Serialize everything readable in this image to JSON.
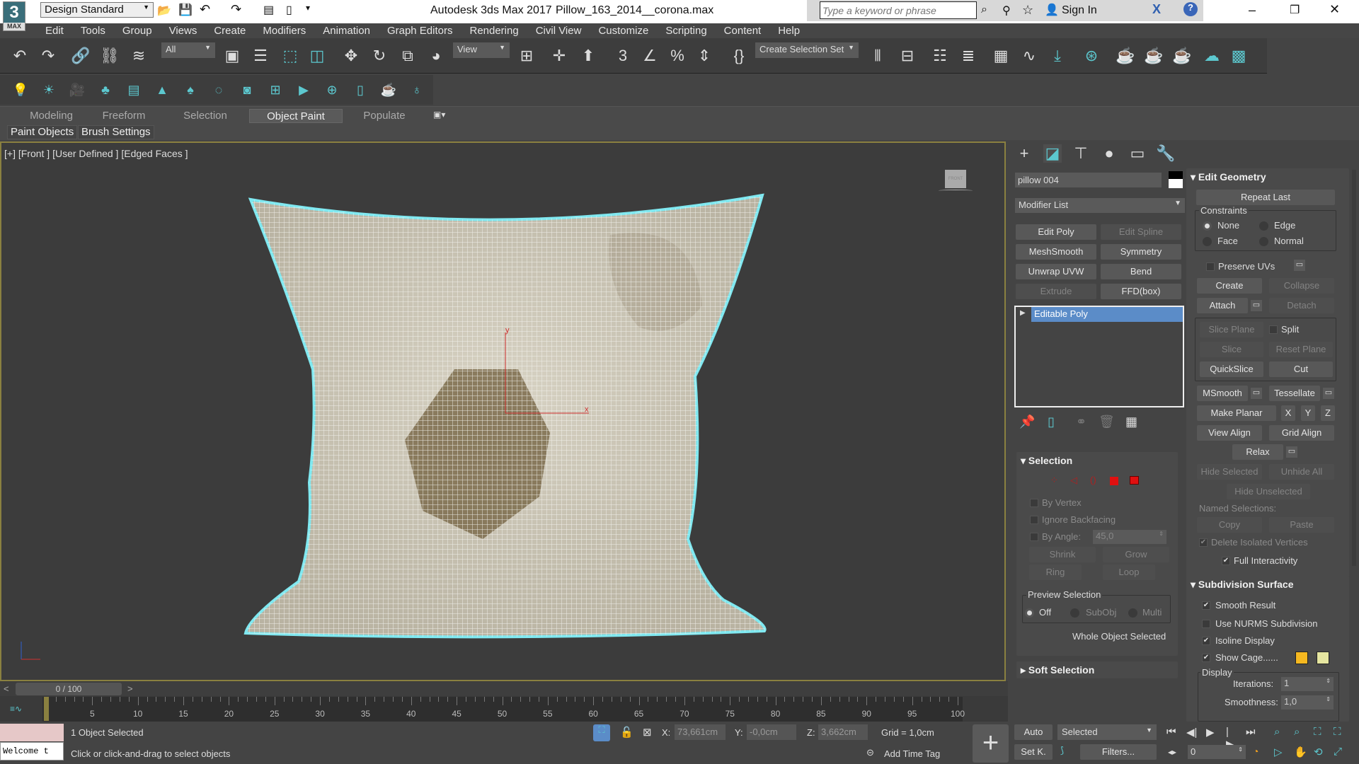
{
  "titlebar": {
    "workspace": "Design Standard",
    "app_title": "Autodesk 3ds Max 2017",
    "file_name": "Pillow_163_2014__corona.max",
    "search_placeholder": "Type a keyword or phrase",
    "sign_in": "Sign In",
    "logo_text": "MAX"
  },
  "menu": [
    "Edit",
    "Tools",
    "Group",
    "Views",
    "Create",
    "Modifiers",
    "Animation",
    "Graph Editors",
    "Rendering",
    "Civil View",
    "Customize",
    "Scripting",
    "Content",
    "Help"
  ],
  "toolbar": {
    "selection_filter": "All",
    "ref_coord": "View",
    "selection_set": "Create Selection Set",
    "icons1": [
      "undo",
      "redo",
      "link",
      "unlink",
      "bind-space-warp",
      "select-object",
      "select-by-name",
      "rect-selection-region",
      "window-crossing",
      "move",
      "rotate",
      "scale",
      "place",
      "use-pivot",
      "select-manipulate",
      "keyboard-shortcut",
      "snaps",
      "angle-snap",
      "percent-snap",
      "spinner-snap",
      "edit-named-selection",
      "mirror",
      "align",
      "toggle-scene-explorer",
      "toggle-layer-explorer",
      "toggle-ribbon",
      "curve-editor",
      "schematic-view",
      "material-editor",
      "render-setup",
      "rendered-frame-window",
      "render-production",
      "render-cloud",
      "render-iterative"
    ],
    "icons2": [
      "light",
      "sun",
      "camera",
      "tree",
      "list",
      "conifer",
      "paint-tree",
      "rotate-ring",
      "sphere-doc",
      "viewport-frame",
      "frame-play",
      "camera-add",
      "panel",
      "teapot",
      "bulb"
    ]
  },
  "ribbon": {
    "tabs": [
      "Modeling",
      "Freeform",
      "Selection",
      "Object Paint",
      "Populate"
    ],
    "active_tab": "Object Paint",
    "panels": [
      "Paint Objects",
      "Brush Settings"
    ]
  },
  "viewport": {
    "label": "[+] [Front ] [User Defined ] [Edged Faces ]",
    "viewcube": "FRONT",
    "gizmo_x": "x",
    "gizmo_y": "y"
  },
  "command_panel": {
    "tabs": [
      "create",
      "modify",
      "hierarchy",
      "motion",
      "display",
      "utilities"
    ],
    "object_name": "pillow 004",
    "modifier_list": "Modifier List",
    "modifier_buttons": [
      "Edit Poly",
      "Edit Spline",
      "MeshSmooth",
      "Symmetry",
      "Unwrap UVW",
      "Bend",
      "Extrude",
      "FFD(box)"
    ],
    "stack": [
      "Editable Poly"
    ],
    "selection": {
      "title": "Selection",
      "by_vertex": "By Vertex",
      "ignore_backfacing": "Ignore Backfacing",
      "by_angle": "By Angle:",
      "angle_value": "45,0",
      "shrink": "Shrink",
      "grow": "Grow",
      "ring": "Ring",
      "loop": "Loop",
      "preview_title": "Preview Selection",
      "preview_options": [
        "Off",
        "SubObj",
        "Multi"
      ],
      "status": "Whole Object Selected"
    },
    "soft_selection": {
      "title": "Soft Selection"
    },
    "edit_geometry": {
      "title": "Edit Geometry",
      "repeat_last": "Repeat Last",
      "constraints": "Constraints",
      "constraint_options": [
        "None",
        "Edge",
        "Face",
        "Normal"
      ],
      "preserve_uvs": "Preserve UVs",
      "create": "Create",
      "collapse": "Collapse",
      "attach": "Attach",
      "detach": "Detach",
      "slice_plane": "Slice Plane",
      "split": "Split",
      "slice": "Slice",
      "reset_plane": "Reset Plane",
      "quickslice": "QuickSlice",
      "cut": "Cut",
      "msmooth": "MSmooth",
      "tessellate": "Tessellate",
      "make_planar": "Make Planar",
      "x": "X",
      "y": "Y",
      "z": "Z",
      "view_align": "View Align",
      "grid_align": "Grid Align",
      "relax": "Relax",
      "hide_selected": "Hide Selected",
      "unhide_all": "Unhide All",
      "hide_unselected": "Hide Unselected",
      "named_selections": "Named Selections:",
      "copy": "Copy",
      "paste": "Paste",
      "delete_isolated": "Delete Isolated Vertices",
      "full_interactivity": "Full Interactivity"
    },
    "subdivision": {
      "title": "Subdivision Surface",
      "smooth_result": "Smooth Result",
      "use_nurms": "Use NURMS Subdivision",
      "isoline": "Isoline Display",
      "show_cage": "Show Cage......",
      "display": "Display",
      "iterations_label": "Iterations:",
      "iterations": "1",
      "smoothness_label": "Smoothness:",
      "smoothness": "1,0",
      "cage_color": "#f5b820",
      "cage_selected_color": "#e6e6a0"
    }
  },
  "timeline": {
    "frame": "0 / 100",
    "prev": "<",
    "next": ">",
    "ticks": [
      "5",
      "10",
      "15",
      "20",
      "25",
      "30",
      "35",
      "40",
      "45",
      "50",
      "55",
      "60",
      "65",
      "70",
      "75",
      "80",
      "85",
      "90",
      "95",
      "100"
    ],
    "zero": "0"
  },
  "status": {
    "selected": "1 Object Selected",
    "prompt": "Click or click-and-drag to select objects",
    "welcome": "Welcome t",
    "x_label": "X:",
    "x": "73,661cm",
    "y_label": "Y:",
    "y": "-0,0cm",
    "z_label": "Z:",
    "z": "3,662cm",
    "grid": "Grid = 1,0cm",
    "add_time_tag": "Add Time Tag",
    "auto": "Auto",
    "set_key": "Set K.",
    "key_mode": "Selected",
    "filters": "Filters...",
    "current_frame": "0"
  },
  "colors": {
    "accent": "#5cc8cf",
    "selection_blue": "#5b8cc8",
    "outline": "#7fe8f0"
  }
}
